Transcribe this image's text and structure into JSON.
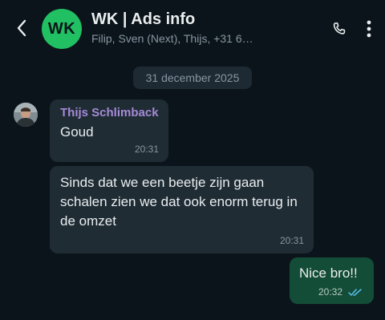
{
  "header": {
    "avatar_initials": "WK",
    "title": "WK | Ads info",
    "subtitle": "Filip, Sven (Next), Thijs, +31 6…"
  },
  "date_separator": "31 december 2025",
  "messages": [
    {
      "direction": "incoming",
      "sender": "Thijs Schlimback",
      "text": "Goud",
      "time": "20:31"
    },
    {
      "direction": "incoming",
      "text": "Sinds dat we een beetje zijn gaan schalen zien we dat ook enorm terug in de omzet",
      "time": "20:31"
    },
    {
      "direction": "outgoing",
      "text": "Nice bro!!",
      "time": "20:32",
      "status_icon": "double-check-read-icon"
    }
  ],
  "colors": {
    "background": "#0b141a",
    "incoming_bubble": "#1f2c34",
    "outgoing_bubble": "#144d37",
    "group_avatar": "#21c063",
    "sender_name": "#a68ad6",
    "read_ticks": "#53bdeb"
  },
  "icons": [
    "back-arrow-icon",
    "phone-icon",
    "more-vert-icon",
    "double-check-read-icon"
  ]
}
